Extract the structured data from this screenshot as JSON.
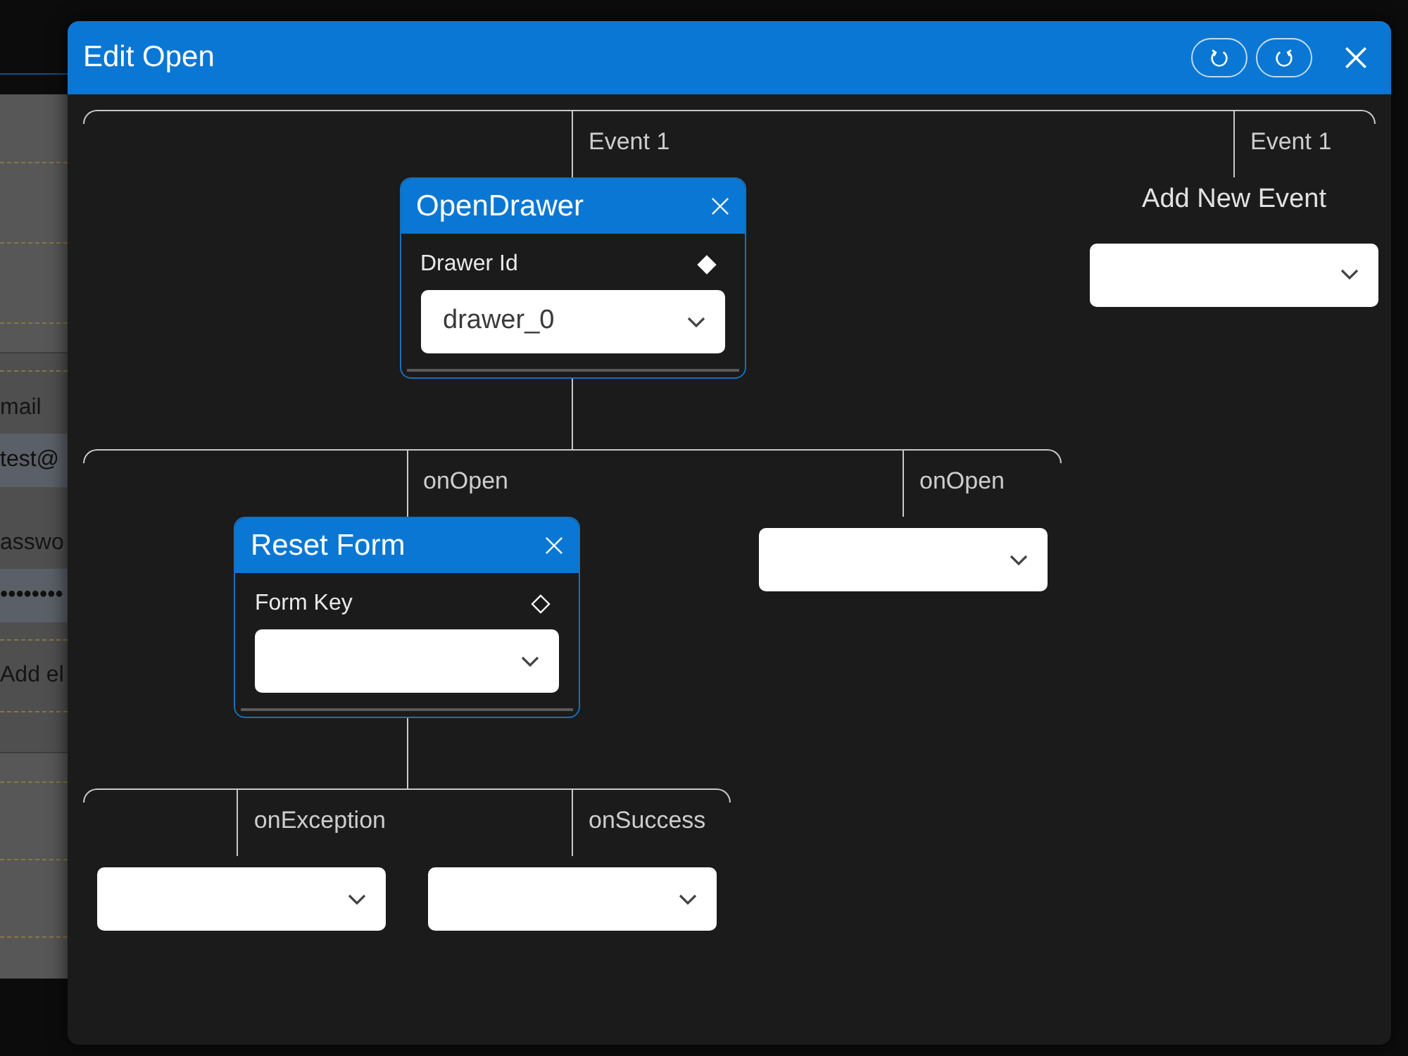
{
  "background_panel": {
    "fields": [
      {
        "label": "mail",
        "value": "test@"
      },
      {
        "label": "asswo",
        "value": "••••••••"
      }
    ],
    "add_link": "Add el"
  },
  "window": {
    "title": "Edit Open"
  },
  "flow": {
    "branches": [
      {
        "label": "Event 1",
        "kind": "action",
        "action": {
          "title": "OpenDrawer",
          "params": [
            {
              "label": "Drawer Id",
              "value": "drawer_0",
              "filled": true
            }
          ],
          "branches": [
            {
              "label": "onOpen",
              "kind": "action",
              "action": {
                "title": "Reset Form",
                "params": [
                  {
                    "label": "Form Key",
                    "filled": false
                  }
                ],
                "branches": [
                  {
                    "label": "onException",
                    "kind": "select"
                  },
                  {
                    "label": "onSuccess",
                    "kind": "select"
                  }
                ]
              }
            },
            {
              "label": "onOpen",
              "kind": "select"
            }
          ]
        }
      },
      {
        "label": "Event 1",
        "kind": "select",
        "heading": "Add New Event"
      }
    ]
  }
}
